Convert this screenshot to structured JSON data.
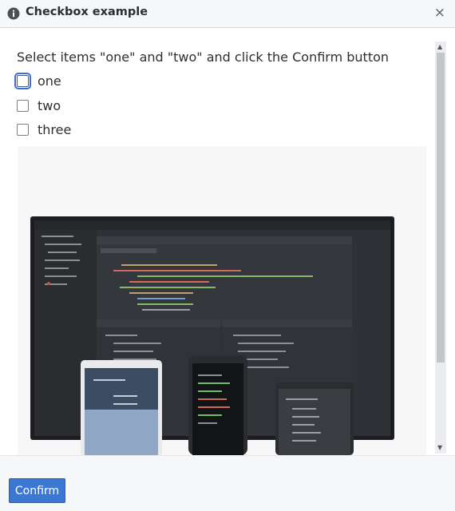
{
  "dialog": {
    "title": "Checkbox example",
    "info_icon": "info-circle-icon",
    "close_icon": "close-icon",
    "close_glyph": "×"
  },
  "instruction": "Select items \"one\" and \"two\" and click the Confirm button",
  "options": [
    {
      "label": "one",
      "checked": false,
      "focused": true
    },
    {
      "label": "two",
      "checked": false,
      "focused": false
    },
    {
      "label": "three",
      "checked": false,
      "focused": false
    }
  ],
  "image": {
    "description_icon": "devices-code-editor-image"
  },
  "footer": {
    "confirm_label": "Confirm"
  },
  "colors": {
    "accent": "#3a78d4",
    "titlebar_bg": "#f6f7f9",
    "focus_ring": "#3b6fd4"
  }
}
